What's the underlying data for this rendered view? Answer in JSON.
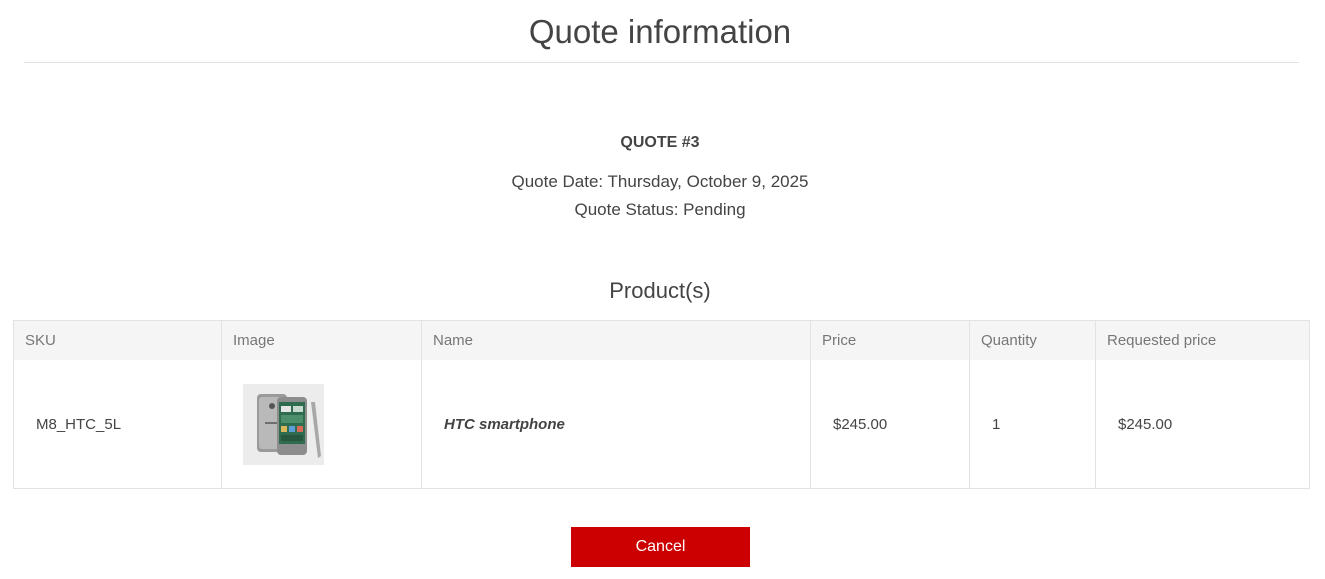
{
  "page": {
    "title": "Quote information"
  },
  "quote": {
    "number_label": "QUOTE #3",
    "date_line": "Quote Date: Thursday, October 9, 2025",
    "status_line": "Quote Status: Pending"
  },
  "products": {
    "section_title": "Product(s)",
    "columns": [
      "SKU",
      "Image",
      "Name",
      "Price",
      "Quantity",
      "Requested price"
    ],
    "rows": [
      {
        "sku": "M8_HTC_5L",
        "image": "phone-thumbnail",
        "name": "HTC smartphone",
        "price": "$245.00",
        "quantity": "1",
        "requested_price": "$245.00"
      }
    ]
  },
  "actions": {
    "cancel_label": "Cancel",
    "cancel_color": "#cc0000"
  },
  "colors": {
    "text": "#444444",
    "header_bg": "#f5f5f5",
    "border": "#e2e2e2"
  }
}
